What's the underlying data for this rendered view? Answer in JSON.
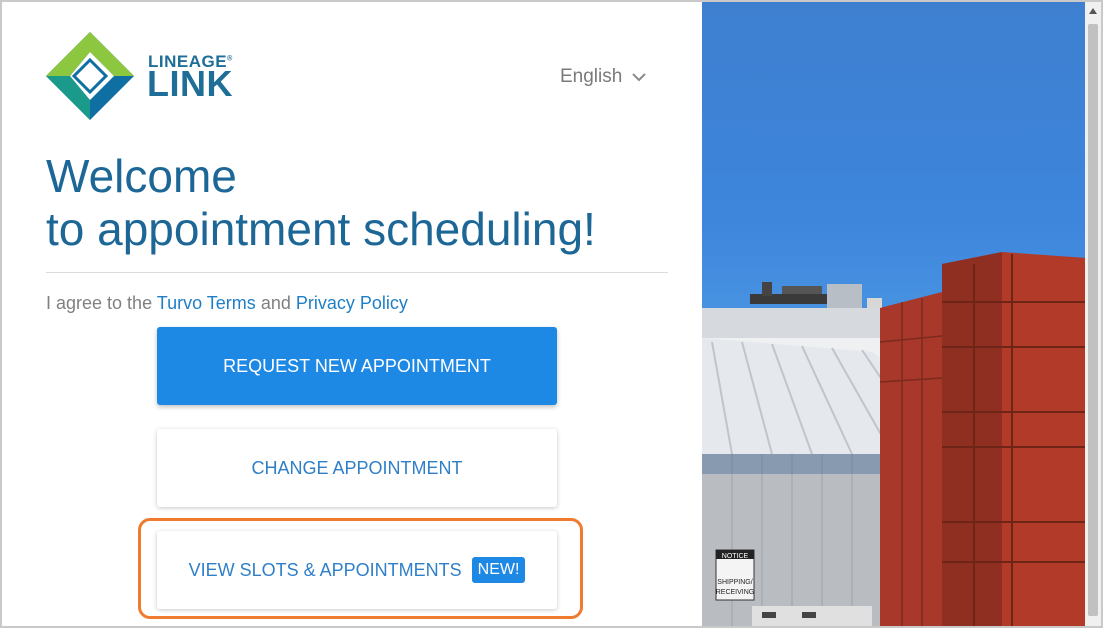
{
  "brand": {
    "name_top": "LINEAGE",
    "name_bottom": "LINK",
    "colors": {
      "primary": "#1f6e98",
      "green": "#8dc63f",
      "teal": "#1a9a8a"
    }
  },
  "language": {
    "selected": "English",
    "icon": "chevron-down-icon"
  },
  "welcome": {
    "line1": "Welcome",
    "line2": "to appointment scheduling!"
  },
  "agreement": {
    "prefix": "I agree to the",
    "terms_link": "Turvo Terms",
    "conjunction": "and",
    "privacy_link": "Privacy Policy"
  },
  "buttons": {
    "request": "REQUEST NEW APPOINTMENT",
    "change": "CHANGE APPOINTMENT",
    "view": "VIEW SLOTS & APPOINTMENTS",
    "new_badge": "NEW!"
  },
  "photo": {
    "sign_title": "NOTICE",
    "sign_text1": "SHIPPING/",
    "sign_text2": "RECEIVING"
  },
  "colors": {
    "accent": "#1e88e5",
    "heading": "#1d6796",
    "highlight": "#f07b2e"
  }
}
